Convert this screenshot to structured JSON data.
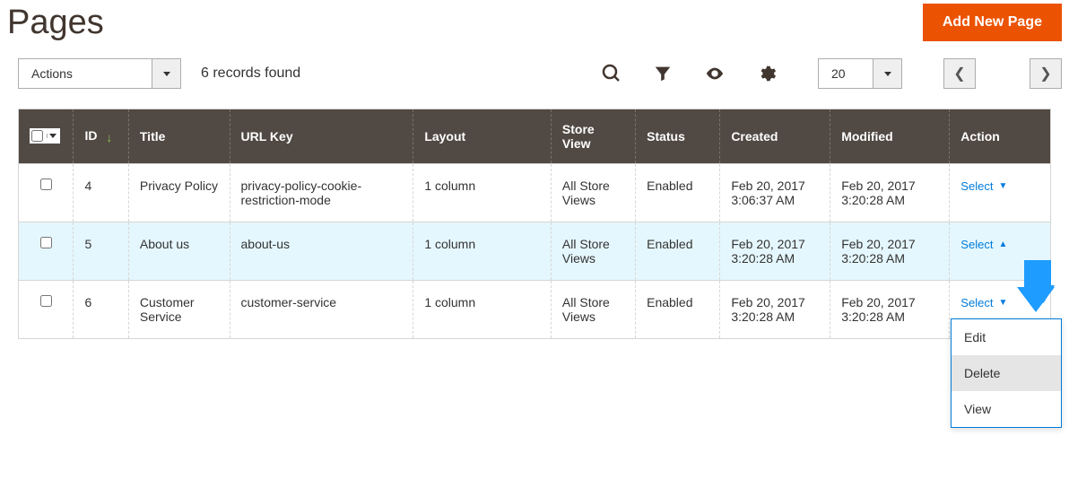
{
  "header": {
    "title": "Pages",
    "add_button": "Add New Page"
  },
  "toolbar": {
    "actions_label": "Actions",
    "records_found": "6 records found",
    "page_size": "20"
  },
  "columns": {
    "id": "ID",
    "title": "Title",
    "url_key": "URL Key",
    "layout": "Layout",
    "store_view": "Store View",
    "status": "Status",
    "created": "Created",
    "modified": "Modified",
    "action": "Action"
  },
  "rows": [
    {
      "id": "4",
      "title": "Privacy Policy",
      "url_key": "privacy-policy-cookie-restriction-mode",
      "layout": "1 column",
      "store_view": "All Store Views",
      "status": "Enabled",
      "created": "Feb 20, 2017 3:06:37 AM",
      "modified": "Feb 20, 2017 3:20:28 AM",
      "action_label": "Select",
      "highlighted": false,
      "open": false
    },
    {
      "id": "5",
      "title": "About us",
      "url_key": "about-us",
      "layout": "1 column",
      "store_view": "All Store Views",
      "status": "Enabled",
      "created": "Feb 20, 2017 3:20:28 AM",
      "modified": "Feb 20, 2017 3:20:28 AM",
      "action_label": "Select",
      "highlighted": true,
      "open": true
    },
    {
      "id": "6",
      "title": "Customer Service",
      "url_key": "customer-service",
      "layout": "1 column",
      "store_view": "All Store Views",
      "status": "Enabled",
      "created": "Feb 20, 2017 3:20:28 AM",
      "modified": "Feb 20, 2017 3:20:28 AM",
      "action_label": "Select",
      "highlighted": false,
      "open": false
    }
  ],
  "dropdown": {
    "edit": "Edit",
    "delete": "Delete",
    "view": "View"
  }
}
